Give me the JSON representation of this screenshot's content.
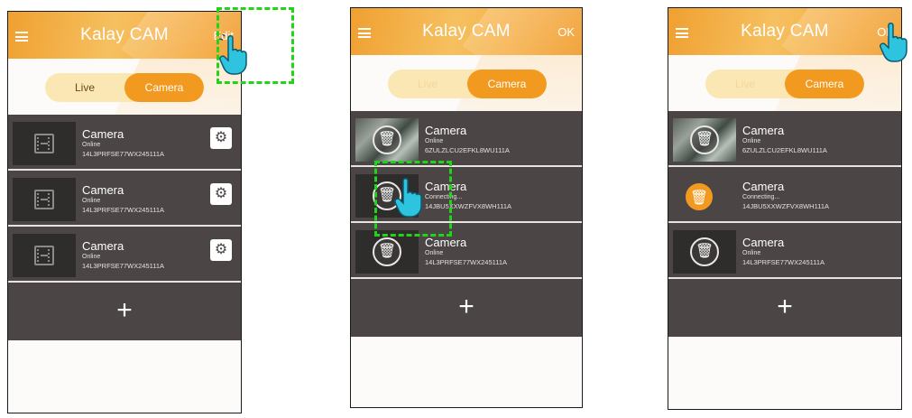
{
  "colors": {
    "header_orange": "#f29a1f",
    "row_dark": "#4b4645",
    "highlight_green": "#22d31a",
    "hand_cyan": "#2ec3df"
  },
  "app": {
    "title": "Kalay CAM"
  },
  "segment": {
    "live": "Live",
    "camera": "Camera"
  },
  "add_label": "+",
  "icons": {
    "menu": "hamburger-icon",
    "gear": "gear-icon",
    "trash": "trash-icon",
    "film": "film-icon",
    "hand": "pointing-hand-icon"
  },
  "panels": [
    {
      "header_button": "Edit",
      "rows": [
        {
          "name": "Camera",
          "status": "Online",
          "uid": "14L3PRFSE77WX245111A"
        },
        {
          "name": "Camera",
          "status": "Online",
          "uid": "14L3PRFSE77WX245111A"
        },
        {
          "name": "Camera",
          "status": "Online",
          "uid": "14L3PRFSE77WX245111A"
        }
      ]
    },
    {
      "header_button": "OK",
      "rows": [
        {
          "name": "Camera",
          "status": "Online",
          "uid": "6ZULZLCU2EFKL8WU111A"
        },
        {
          "name": "Camera",
          "status": "Connecting...",
          "uid": "14JBU5XXWZFVX8WH111A"
        },
        {
          "name": "Camera",
          "status": "Online",
          "uid": "14L3PRFSE77WX245111A"
        }
      ]
    },
    {
      "header_button": "OK",
      "rows": [
        {
          "name": "Camera",
          "status": "Online",
          "uid": "6ZULZLCU2EFKL8WU111A"
        },
        {
          "name": "Camera",
          "status": "Connecting...",
          "uid": "14JBU5XXWZFVX8WH111A"
        },
        {
          "name": "Camera",
          "status": "Online",
          "uid": "14L3PRFSE77WX245111A"
        }
      ]
    }
  ]
}
